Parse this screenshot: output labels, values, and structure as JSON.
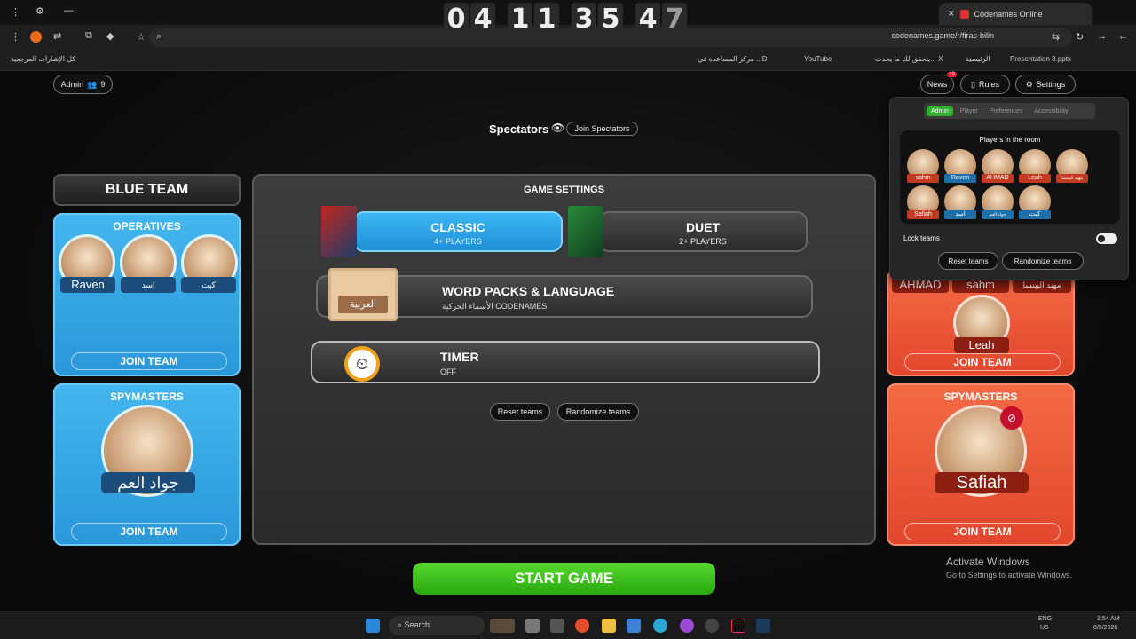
{
  "browser": {
    "tab_title": "Codenames Online",
    "url": "codenames.game/r/firas-bilin",
    "bookmarks": [
      "Presentation 8.pptx",
      "الرئيسية",
      "يتحقق لك ما يحدث... X",
      "YouTube",
      "مركز المساعدة في ...D"
    ],
    "bookmarks_folder": "كل الإشارات المرجعية"
  },
  "countdown": [
    "0",
    "4",
    "1",
    "1",
    "3",
    "5",
    "4",
    "7"
  ],
  "topbar": {
    "admin_label": "Admin",
    "player_count": "9",
    "news_label": "News",
    "news_badge": "19",
    "rules_label": "Rules",
    "settings_label": "Settings"
  },
  "spectators": {
    "label": "Spectators",
    "join_label": "Join Spectators"
  },
  "blue_team": {
    "title": "BLUE TEAM",
    "operatives_label": "OPERATIVES",
    "operatives": [
      "Raven",
      "اسد",
      "كيت"
    ],
    "spymasters_label": "SPYMASTERS",
    "spymaster": "جواد العم",
    "join_label": "JOIN TEAM"
  },
  "red_team": {
    "operatives": [
      "AHMAD",
      "sahm",
      "مهند البيتسا"
    ],
    "operative_featured": "Leah",
    "spymasters_label": "SPYMASTERS",
    "spymaster": "Safiah",
    "join_label": "JOIN TEAM"
  },
  "game_settings": {
    "title": "GAME SETTINGS",
    "classic_title": "CLASSIC",
    "classic_sub": "4+ PLAYERS",
    "duet_title": "DUET",
    "duet_sub": "2+ PLAYERS",
    "wordpacks_title": "WORD PACKS & LANGUAGE",
    "wordpacks_sub": "الأسماء الحركية CODENAMES",
    "wordpacks_badge": "العربية",
    "timer_title": "TIMER",
    "timer_sub": "OFF",
    "reset_label": "Reset teams",
    "randomize_label": "Randomize teams",
    "start_label": "START GAME"
  },
  "admin_popup": {
    "tabs": [
      "Admin",
      "Player",
      "Preferences",
      "Accessibility"
    ],
    "active_tab": "Admin",
    "players_title": "Players in the room",
    "players": [
      {
        "name": "sahm",
        "team": "red"
      },
      {
        "name": "Raven",
        "team": "blue"
      },
      {
        "name": "AHMAD",
        "team": "red"
      },
      {
        "name": "Leah",
        "team": "red"
      },
      {
        "name": "مهند البيتسا",
        "team": "red"
      },
      {
        "name": "Safiah",
        "team": "red"
      },
      {
        "name": "اسد",
        "team": "blue"
      },
      {
        "name": "جواد العم",
        "team": "blue"
      },
      {
        "name": "كيت",
        "team": "blue"
      }
    ],
    "lock_label": "Lock teams",
    "reset_label": "Reset teams",
    "randomize_label": "Randomize teams"
  },
  "windows": {
    "activate_title": "Activate Windows",
    "activate_sub": "Go to Settings to activate Windows."
  },
  "taskbar": {
    "search_label": "Search",
    "lang_top": "ENG",
    "lang_bottom": "US",
    "time": "3:54 AM",
    "date": "8/5/2026"
  },
  "colors": {
    "blue": "#2a97d9",
    "red": "#e2472c",
    "green": "#2aa811"
  }
}
